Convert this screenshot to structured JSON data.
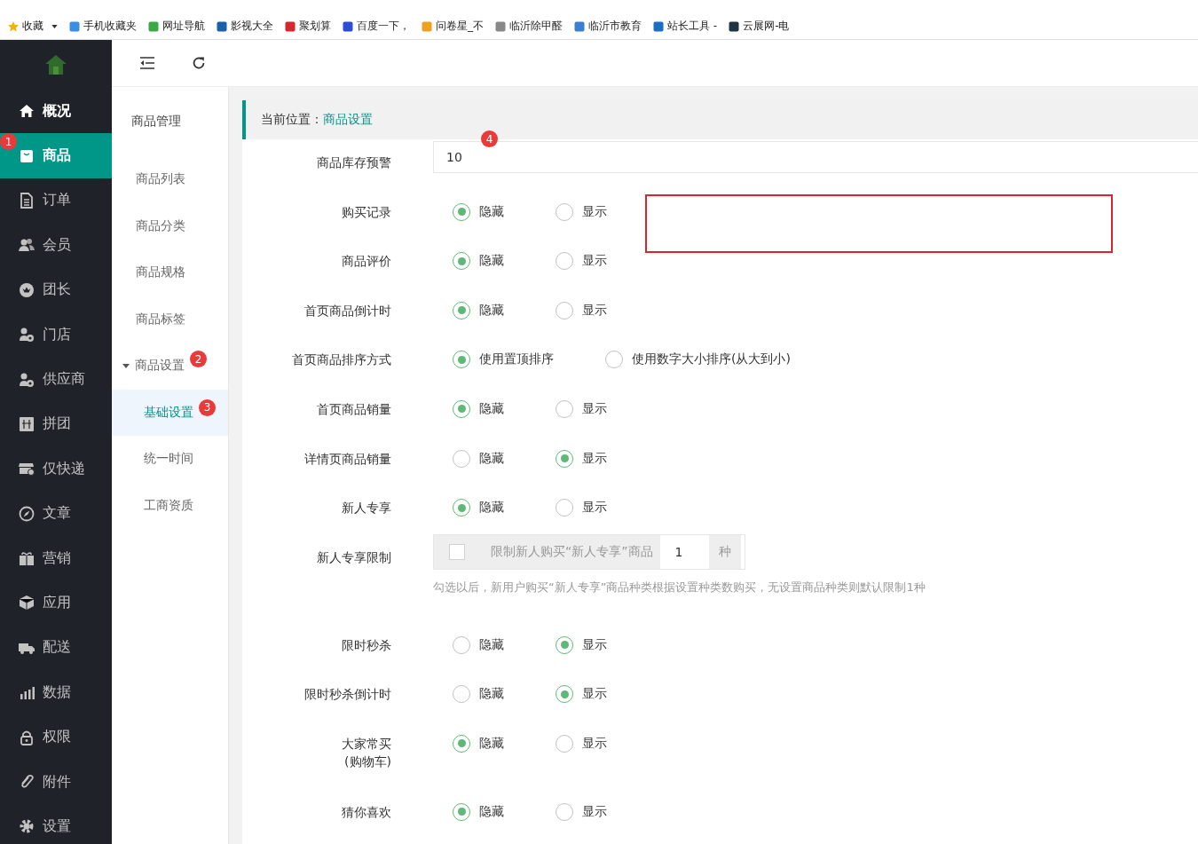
{
  "bookmarks": [
    {
      "label": "收藏",
      "dropdown": true
    },
    {
      "label": "手机收藏夹"
    },
    {
      "label": "网址导航"
    },
    {
      "label": "影视大全"
    },
    {
      "label": "聚划算"
    },
    {
      "label": "百度一下，"
    },
    {
      "label": "问卷星_不"
    },
    {
      "label": "临沂除甲醛"
    },
    {
      "label": "临沂市教育"
    },
    {
      "label": "站长工具 -"
    },
    {
      "label": "云展网-电"
    }
  ],
  "sidebar": {
    "items": [
      {
        "label": "概况",
        "selected": false,
        "highlighted": true
      },
      {
        "label": "商品",
        "selected": true,
        "highlighted": true,
        "badge": "1"
      },
      {
        "label": "订单",
        "selected": false,
        "highlighted": false
      },
      {
        "label": "会员",
        "selected": false,
        "highlighted": false
      },
      {
        "label": "团长",
        "selected": false,
        "highlighted": false
      },
      {
        "label": "门店",
        "selected": false,
        "highlighted": false
      },
      {
        "label": "供应商",
        "selected": false,
        "highlighted": false
      },
      {
        "label": "拼团",
        "selected": false,
        "highlighted": false
      },
      {
        "label": "仅快递",
        "selected": false,
        "highlighted": false
      },
      {
        "label": "文章",
        "selected": false,
        "highlighted": false
      },
      {
        "label": "营销",
        "selected": false,
        "highlighted": false
      },
      {
        "label": "应用",
        "selected": false,
        "highlighted": false
      },
      {
        "label": "配送",
        "selected": false,
        "highlighted": false
      },
      {
        "label": "数据",
        "selected": false,
        "highlighted": false
      },
      {
        "label": "权限",
        "selected": false,
        "highlighted": false
      },
      {
        "label": "附件",
        "selected": false,
        "highlighted": false
      },
      {
        "label": "设置",
        "selected": false,
        "highlighted": false
      }
    ]
  },
  "subnav": {
    "title": "商品管理",
    "items": [
      {
        "label": "商品列表",
        "selected": false
      },
      {
        "label": "商品分类",
        "selected": false
      },
      {
        "label": "商品规格",
        "selected": false
      },
      {
        "label": "商品标签",
        "selected": false
      },
      {
        "label": "商品设置",
        "selected": false,
        "expanded": true,
        "badge": "2",
        "children": [
          {
            "label": "基础设置",
            "selected": true,
            "badge": "3"
          },
          {
            "label": "统一时间",
            "selected": false
          },
          {
            "label": "工商资质",
            "selected": false
          }
        ]
      }
    ]
  },
  "breadcrumb": {
    "prefix": "当前位置：",
    "current": "商品设置"
  },
  "form": {
    "rows": [
      {
        "kind": "input",
        "label": "商品库存预警",
        "value": "10",
        "badge": "4"
      },
      {
        "kind": "radio",
        "label": "购买记录",
        "options": [
          {
            "label": "隐藏",
            "selected": true
          },
          {
            "label": "显示",
            "selected": false
          }
        ]
      },
      {
        "kind": "radio",
        "label": "商品评价",
        "options": [
          {
            "label": "隐藏",
            "selected": true
          },
          {
            "label": "显示",
            "selected": false
          }
        ]
      },
      {
        "kind": "radio",
        "label": "首页商品倒计时",
        "options": [
          {
            "label": "隐藏",
            "selected": true
          },
          {
            "label": "显示",
            "selected": false
          }
        ]
      },
      {
        "kind": "radio",
        "label": "首页商品排序方式",
        "options": [
          {
            "label": "使用置顶排序",
            "selected": true
          },
          {
            "label": "使用数字大小排序(从大到小)",
            "selected": false
          }
        ]
      },
      {
        "kind": "radio",
        "label": "首页商品销量",
        "options": [
          {
            "label": "隐藏",
            "selected": true
          },
          {
            "label": "显示",
            "selected": false
          }
        ]
      },
      {
        "kind": "radio",
        "label": "详情页商品销量",
        "options": [
          {
            "label": "隐藏",
            "selected": false
          },
          {
            "label": "显示",
            "selected": true
          }
        ]
      },
      {
        "kind": "radio",
        "label": "新人专享",
        "options": [
          {
            "label": "隐藏",
            "selected": true
          },
          {
            "label": "显示",
            "selected": false
          }
        ]
      },
      {
        "kind": "limit",
        "label": "新人专享限制",
        "checked": false,
        "prefix": "限制新人购买“新人专享”商品",
        "value": "1",
        "suffix": "种",
        "help": "勾选以后，新用户购买“新人专享”商品种类根据设置种类数购买，无设置商品种类则默认限制1种"
      },
      {
        "kind": "radio",
        "label": "限时秒杀",
        "options": [
          {
            "label": "隐藏",
            "selected": false
          },
          {
            "label": "显示",
            "selected": true
          }
        ]
      },
      {
        "kind": "radio",
        "label": "限时秒杀倒计时",
        "options": [
          {
            "label": "隐藏",
            "selected": false
          },
          {
            "label": "显示",
            "selected": true
          }
        ]
      },
      {
        "kind": "radio",
        "label": "大家常买",
        "sublabel": "(购物车)",
        "options": [
          {
            "label": "隐藏",
            "selected": true
          },
          {
            "label": "显示",
            "selected": false
          }
        ]
      },
      {
        "kind": "radio",
        "label": "猜你喜欢",
        "options": [
          {
            "label": "隐藏",
            "selected": true
          },
          {
            "label": "显示",
            "selected": false
          }
        ]
      }
    ]
  }
}
